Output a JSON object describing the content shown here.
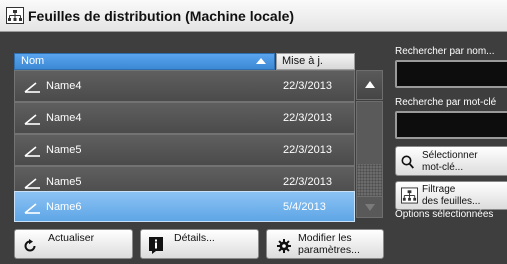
{
  "window": {
    "title": "Feuilles de distribution (Machine locale)"
  },
  "table": {
    "columns": {
      "name": "Nom",
      "updated": "Mise à j."
    },
    "rows": [
      {
        "name": "Name4",
        "date": "22/3/2013"
      },
      {
        "name": "Name4",
        "date": "22/3/2013"
      },
      {
        "name": "Name5",
        "date": "22/3/2013"
      },
      {
        "name": "Name5",
        "date": "22/3/2013"
      },
      {
        "name": "Name6",
        "date": "5/4/2013"
      }
    ],
    "selected_row_index": 4
  },
  "side": {
    "search_by_name_label": "Rechercher par nom...",
    "search_by_name_value": "",
    "search_by_keyword_label": "Recherche par mot-clé",
    "search_by_keyword_value": "",
    "select_keyword_line1": "Sélectionner",
    "select_keyword_line2": "mot-clé...",
    "filter_line1": "Filtrage",
    "filter_line2": "des feuilles...",
    "options_selected": "Options sélectionnées"
  },
  "footer": {
    "refresh_label": "Actualiser",
    "details_label": "Détails...",
    "modify_line1": "Modifier les",
    "modify_line2": "paramètres..."
  },
  "colors": {
    "selection": "#6aaeea",
    "header_accent": "#3c88d4",
    "background": "#3e3e3e"
  },
  "icons": [
    "distribution-sheet-icon",
    "sort-ascending-icon",
    "sheet-item-icon",
    "scroll-up-icon",
    "scroll-down-icon",
    "search-icon",
    "filter-icon",
    "refresh-icon",
    "info-icon",
    "gear-icon"
  ]
}
